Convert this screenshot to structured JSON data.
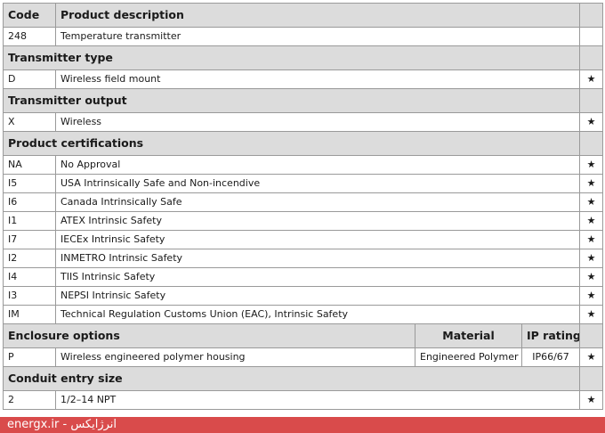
{
  "header": {
    "code": "Code",
    "description": "Product description"
  },
  "intro_row": {
    "code": "248",
    "description": "Temperature transmitter"
  },
  "transmitter_type": {
    "title": "Transmitter type",
    "rows": [
      {
        "code": "D",
        "description": "Wireless field mount",
        "star": "★"
      }
    ]
  },
  "transmitter_output": {
    "title": "Transmitter output",
    "rows": [
      {
        "code": "X",
        "description": "Wireless",
        "star": "★"
      }
    ]
  },
  "certifications": {
    "title": "Product certifications",
    "rows": [
      {
        "code": "NA",
        "description": "No Approval",
        "star": "★"
      },
      {
        "code": "I5",
        "description": "USA Intrinsically Safe and Non-incendive",
        "star": "★"
      },
      {
        "code": "I6",
        "description": "Canada Intrinsically Safe",
        "star": "★"
      },
      {
        "code": "I1",
        "description": "ATEX Intrinsic Safety",
        "star": "★"
      },
      {
        "code": "I7",
        "description": "IECEx Intrinsic Safety",
        "star": "★"
      },
      {
        "code": "I2",
        "description": "INMETRO Intrinsic Safety",
        "star": "★"
      },
      {
        "code": "I4",
        "description": "TIIS Intrinsic Safety",
        "star": "★"
      },
      {
        "code": "I3",
        "description": "NEPSI Intrinsic Safety",
        "star": "★"
      },
      {
        "code": "IM",
        "description": "Technical Regulation Customs Union (EAC), Intrinsic Safety",
        "star": "★"
      }
    ]
  },
  "enclosure": {
    "title": "Enclosure options",
    "material_header": "Material",
    "ip_header": "IP rating",
    "rows": [
      {
        "code": "P",
        "description": "Wireless engineered polymer housing",
        "material": "Engineered Polymer",
        "ip": "IP66/67",
        "star": "★"
      }
    ]
  },
  "conduit": {
    "title": "Conduit entry size",
    "rows": [
      {
        "code": "2",
        "description": "1/2–14 NPT",
        "star": "★"
      }
    ]
  },
  "footer": {
    "text": "energx.ir - انرژایکس"
  }
}
